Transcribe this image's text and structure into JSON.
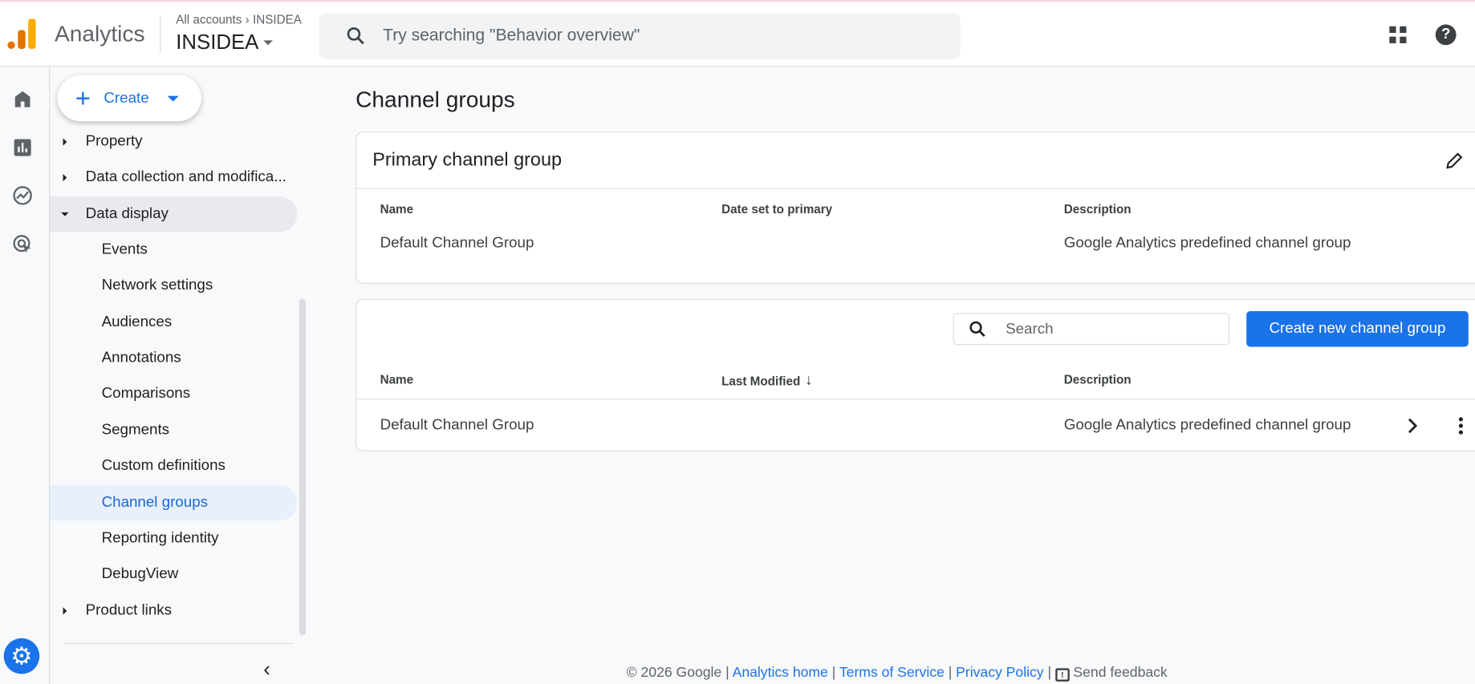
{
  "header": {
    "app_name": "Analytics",
    "breadcrumb_root": "All accounts",
    "breadcrumb_current": "INSIDEA",
    "property_name": "INSIDEA",
    "search_placeholder": "Try searching \"Behavior overview\""
  },
  "nav": {
    "create_label": "Create",
    "items": [
      {
        "label": "Property"
      },
      {
        "label": "Data collection and modifica..."
      },
      {
        "label": "Data display"
      },
      {
        "label": "Events"
      },
      {
        "label": "Network settings"
      },
      {
        "label": "Audiences"
      },
      {
        "label": "Annotations"
      },
      {
        "label": "Comparisons"
      },
      {
        "label": "Segments"
      },
      {
        "label": "Custom definitions"
      },
      {
        "label": "Channel groups"
      },
      {
        "label": "Reporting identity"
      },
      {
        "label": "DebugView"
      },
      {
        "label": "Product links"
      }
    ]
  },
  "main": {
    "title": "Channel groups",
    "primary": {
      "title": "Primary channel group",
      "columns": [
        "Name",
        "Date set to primary",
        "Description"
      ],
      "row": [
        "Default Channel Group",
        "",
        "Google Analytics predefined channel group"
      ]
    },
    "list": {
      "search_placeholder": "Search",
      "create_button": "Create new channel group",
      "columns": [
        "Name",
        "Last Modified",
        "Description"
      ],
      "rows": [
        [
          "Default Channel Group",
          "",
          "Google Analytics predefined channel group"
        ]
      ]
    }
  },
  "footer": {
    "copyright": "© 2026 Google",
    "links": [
      "Analytics home",
      "Terms of Service",
      "Privacy Policy"
    ],
    "feedback": "Send feedback"
  },
  "colors": {
    "accent": "#1a73e8",
    "active_bg": "#e8f0fe",
    "logo_orange": "#f9ab00",
    "logo_dark": "#e37400"
  }
}
